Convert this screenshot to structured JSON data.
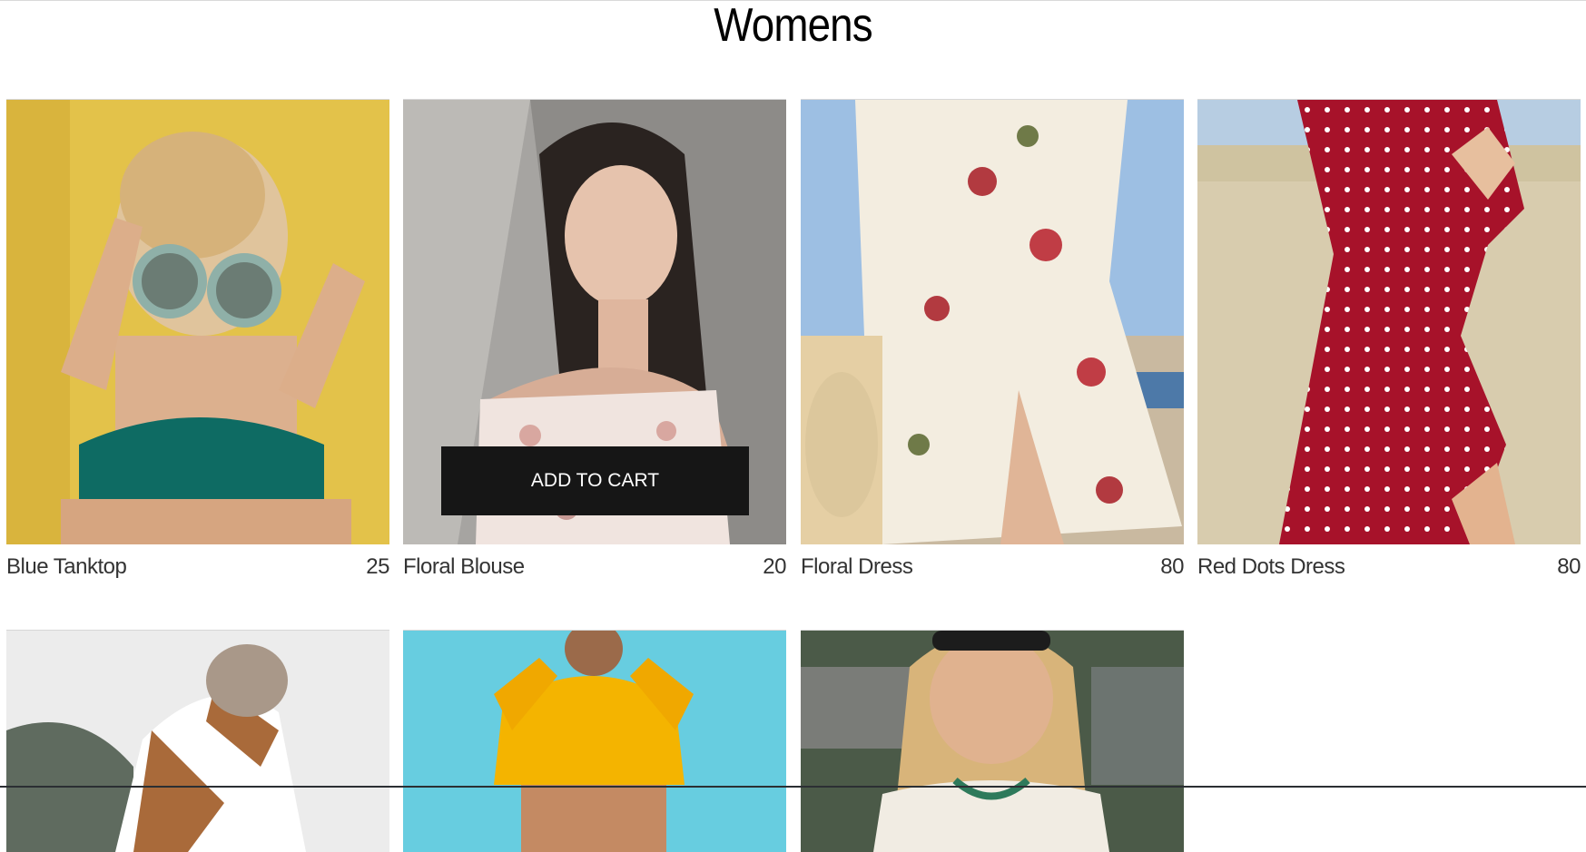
{
  "page": {
    "title": "Womens"
  },
  "products": [
    {
      "name": "Blue Tanktop",
      "price": "25",
      "image": "woman-blue-tanktop-photo"
    },
    {
      "name": "Floral Blouse",
      "price": "20",
      "image": "woman-floral-blouse-photo",
      "hover_action": "ADD TO CART"
    },
    {
      "name": "Floral Dress",
      "price": "80",
      "image": "woman-floral-dress-photo"
    },
    {
      "name": "Red Dots Dress",
      "price": "80",
      "image": "woman-red-dots-dress-photo"
    }
  ],
  "products_row2": [
    {
      "image": "woman-striped-sweater-photo"
    },
    {
      "image": "woman-yellow-hoodie-photo"
    },
    {
      "image": "woman-braids-sunglasses-photo"
    }
  ]
}
